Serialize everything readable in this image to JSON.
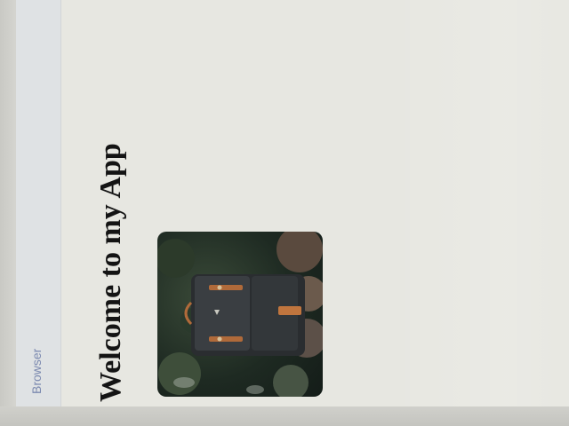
{
  "browser": {
    "title": "Browser"
  },
  "page": {
    "heading": "Welcome to my App"
  },
  "image": {
    "subject": "backpack-photo"
  }
}
